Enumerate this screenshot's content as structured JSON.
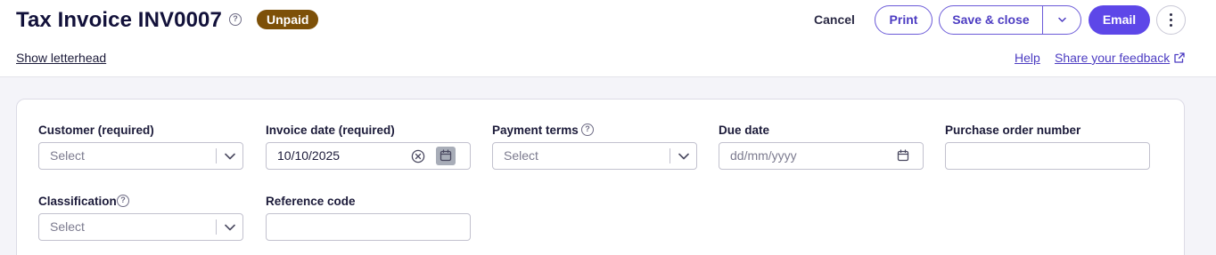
{
  "header": {
    "title": "Tax Invoice INV0007",
    "status_badge": "Unpaid",
    "show_letterhead": "Show letterhead",
    "help_glyph": "?"
  },
  "actions": {
    "cancel": "Cancel",
    "print": "Print",
    "save_close": "Save & close",
    "email": "Email"
  },
  "links": {
    "help": "Help",
    "feedback": "Share your feedback"
  },
  "form": {
    "customer": {
      "label": "Customer (required)",
      "placeholder": "Select"
    },
    "invoice_date": {
      "label": "Invoice date (required)",
      "value": "10/10/2025"
    },
    "payment_terms": {
      "label": "Payment terms",
      "placeholder": "Select"
    },
    "due_date": {
      "label": "Due date",
      "placeholder": "dd/mm/yyyy"
    },
    "purchase_order": {
      "label": "Purchase order number",
      "value": ""
    },
    "classification": {
      "label": "Classification",
      "placeholder": "Select"
    },
    "reference_code": {
      "label": "Reference code",
      "value": ""
    }
  },
  "colors": {
    "accent": "#5d47e8",
    "badge_unpaid": "#7d5008",
    "link": "#4c3cc2"
  },
  "icons": [
    "help-circle-icon",
    "chevron-down-icon",
    "clear-circle-icon",
    "calendar-icon",
    "more-vertical-icon",
    "external-link-icon"
  ]
}
